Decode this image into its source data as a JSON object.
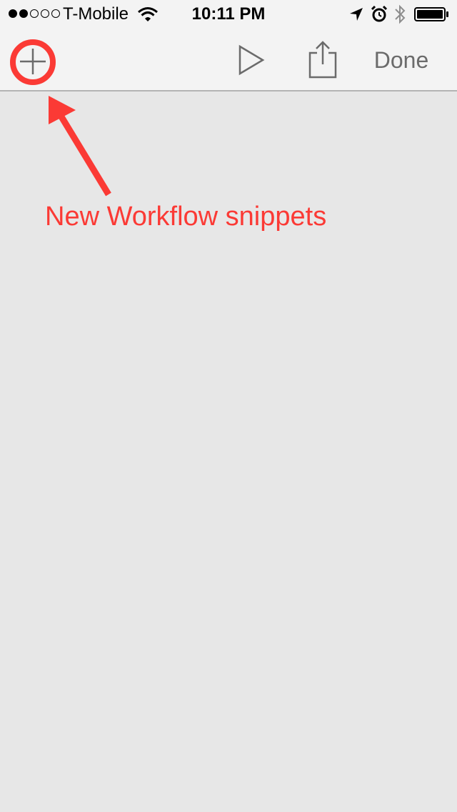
{
  "status_bar": {
    "carrier": "T-Mobile",
    "time": "10:11 PM"
  },
  "icons": {
    "signal": "signal-dots-icon",
    "wifi": "wifi-icon",
    "location": "location-arrow-icon",
    "alarm": "alarm-clock-icon",
    "bluetooth": "bluetooth-icon",
    "battery": "battery-icon",
    "add": "plus-icon",
    "play": "play-icon",
    "share": "share-icon"
  },
  "toolbar": {
    "done_label": "Done"
  },
  "annotation": {
    "label": "New Workflow snippets",
    "color": "#fb3a35"
  },
  "colors": {
    "toolbar_background": "#f3f3f3",
    "content_background": "#e7e7e7",
    "icon_gray": "#6b6b6b"
  }
}
